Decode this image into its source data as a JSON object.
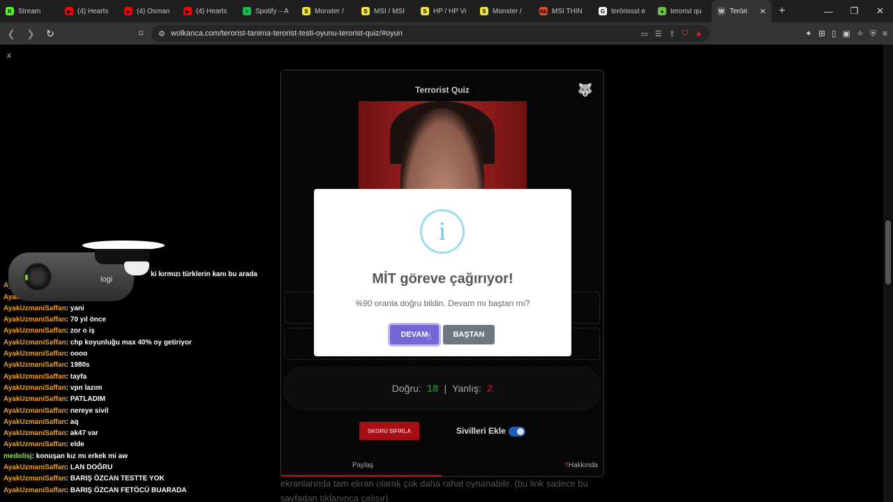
{
  "browser": {
    "tabs": [
      {
        "title": "Stream",
        "fav_color": "#53fc18",
        "fav_char": "K"
      },
      {
        "title": "(4) Hearts",
        "fav_color": "#ff0000",
        "fav_char": "▶"
      },
      {
        "title": "(4) Osman",
        "fav_color": "#ff0000",
        "fav_char": "▶"
      },
      {
        "title": "(4) Hearts",
        "fav_color": "#ff0000",
        "fav_char": "▶"
      },
      {
        "title": "Spotify – A",
        "fav_color": "#1db954",
        "fav_char": "≈"
      },
      {
        "title": "Monster /",
        "fav_color": "#f5e63c",
        "fav_char": "S"
      },
      {
        "title": "MSI / MSI",
        "fav_color": "#f5e63c",
        "fav_char": "S"
      },
      {
        "title": "HP / HP Vi",
        "fav_color": "#f5e63c",
        "fav_char": "S"
      },
      {
        "title": "Monster /",
        "fav_color": "#f5e63c",
        "fav_char": "S"
      },
      {
        "title": "MSI THIN",
        "fav_color": "#e44d26",
        "fav_char": "hb"
      },
      {
        "title": "terörissst e",
        "fav_color": "#ffffff",
        "fav_char": "G"
      },
      {
        "title": "terorist qu",
        "fav_color": "#6cc04a",
        "fav_char": "●"
      }
    ],
    "active_tab": {
      "title": "Teröri",
      "fav_char": "W"
    },
    "new_tab": "+",
    "win_controls": {
      "minimize": "—",
      "restore": "❐",
      "close": "✕"
    },
    "url": "wolkanca.com/terorist-tanima-terorist-testi-oyunu-terorist-quiz/#oyun"
  },
  "overlay_close": "x",
  "quiz": {
    "title": "Terrorist Quiz",
    "score_correct_label": "Doğru:",
    "score_correct": "18",
    "separator": "|",
    "score_wrong_label": "Yanlış:",
    "score_wrong": "2",
    "reset_button": "SKORU SIFIRLA",
    "civilians_label": "Sivilleri Ekle",
    "civilians_on": true,
    "share_link": "Paylaş",
    "about_mark": "?",
    "about_link": "Hakkında"
  },
  "page_text": "ekranlarında tam ekran olarak çok daha rahat oynanabilir. (bu link sadece bu sayfadan tıklanınca çalışır)",
  "modal": {
    "icon": "i",
    "title": "MİT göreve çağırıyor!",
    "percent": "%90",
    "text": "oranla doğru bildin. Devam mı baştan mı?",
    "continue_button": "DEVAM",
    "restart_button": "BAŞTAN"
  },
  "webcam_label": "logi",
  "chat": [
    {
      "user": "",
      "text": "ki kırmızı türklerin kanı bu arada"
    },
    {
      "user": "AyakUzmaniSaffan",
      "text": ""
    },
    {
      "user": "AyakUzmaniSaffan",
      "text": ""
    },
    {
      "user": "AyakUzmaniSaffan",
      "text": ": yani"
    },
    {
      "user": "AyakUzmaniSaffan",
      "text": ": 70 yıl önce"
    },
    {
      "user": "AyakUzmaniSaffan",
      "text": ": zor o iş"
    },
    {
      "user": "AyakUzmaniSaffan",
      "text": ": chp koyunluğu max 40% oy getiriyor"
    },
    {
      "user": "AyakUzmaniSaffan",
      "text": ": oooo"
    },
    {
      "user": "AyakUzmaniSaffan",
      "text": ": 1980s"
    },
    {
      "user": "AyakUzmaniSaffan",
      "text": ": tayfa"
    },
    {
      "user": "AyakUzmaniSaffan",
      "text": ": vpn lazım"
    },
    {
      "user": "AyakUzmaniSaffan",
      "text": ": PATLADIM"
    },
    {
      "user": "AyakUzmaniSaffan",
      "text": ": nereye sivil"
    },
    {
      "user": "AyakUzmaniSaffan",
      "text": ": aq"
    },
    {
      "user": "AyakUzmaniSaffan",
      "text": ": ak47 var"
    },
    {
      "user": "AyakUzmaniSaffan",
      "text": ": elde"
    },
    {
      "user": "medolisj",
      "text": ": konuşan kız mı erkek mi aw",
      "alt": true
    },
    {
      "user": "AyakUzmaniSaffan",
      "text": ": LAN DOĞRU"
    },
    {
      "user": "AyakUzmaniSaffan",
      "text": ": BARIŞ ÖZCAN TESTTE YOK"
    },
    {
      "user": "AyakUzmaniSaffan",
      "text": ": BARIŞ ÖZCAN FETÖCÜ BUARADA"
    }
  ]
}
